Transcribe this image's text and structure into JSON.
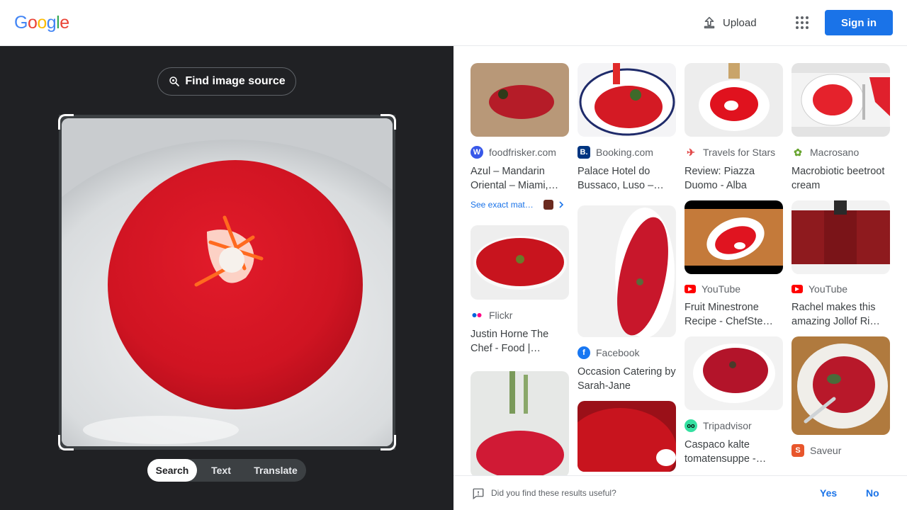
{
  "header": {
    "logo_text": "Google",
    "logo_colors": [
      "#4285f4",
      "#ea4335",
      "#fbbc05",
      "#4285f4",
      "#34a853",
      "#ea4335"
    ],
    "upload_label": "Upload",
    "signin_label": "Sign in"
  },
  "lens": {
    "find_source_label": "Find image source",
    "modes": [
      "Search",
      "Text",
      "Translate"
    ],
    "active_mode": "Search"
  },
  "results": {
    "col1": [
      {
        "source": "foodfrisker.com",
        "favicon": "wordpress-icon",
        "title": "Azul – Mandarin Oriental – Miami,…",
        "exact_match": "See exact mat…"
      },
      {
        "source": "Flickr",
        "favicon": "flickr-icon",
        "title": "Justin Horne The Chef - Food |…"
      }
    ],
    "col2": [
      {
        "source": "Booking.com",
        "favicon": "booking-icon",
        "title": "Palace Hotel do Bussaco, Luso –…"
      },
      {
        "source": "Facebook",
        "favicon": "facebook-icon",
        "title": "Occasion Catering by Sarah-Jane"
      }
    ],
    "col3": [
      {
        "source": "Travels for Stars",
        "favicon": "plane-icon",
        "title": "Review: Piazza Duomo - Alba"
      },
      {
        "source": "YouTube",
        "favicon": "youtube-icon",
        "title": "Fruit Minestrone Recipe - ChefSte…"
      },
      {
        "source": "Tripadvisor",
        "favicon": "tripadvisor-icon",
        "title": "Caspaco kalte tomatensuppe -…"
      }
    ],
    "col4": [
      {
        "source": "Macrosano",
        "favicon": "leaf-icon",
        "title": "Macrobiotic beetroot cream"
      },
      {
        "source": "YouTube",
        "favicon": "youtube-icon",
        "title": "Rachel makes this amazing Jollof Ri…"
      },
      {
        "source": "Saveur",
        "favicon": "saveur-icon",
        "title": ""
      }
    ]
  },
  "feedback": {
    "question": "Did you find these results useful?",
    "yes_label": "Yes",
    "no_label": "No"
  }
}
